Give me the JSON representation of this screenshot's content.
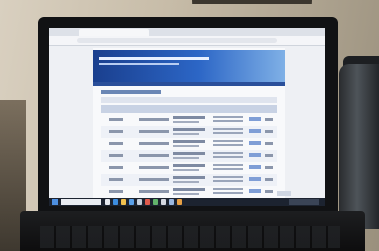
{
  "scene": {
    "subject": "laptop-displaying-web-page",
    "browser": {
      "tab_title": "",
      "address": ""
    },
    "web_page": {
      "site_title": "",
      "row_count": 7
    },
    "colors": {
      "banner": "#2c66c6",
      "taskbar": "#1c2330",
      "table_header": "#c8d2e4"
    },
    "taskbar_icons": [
      "windows-start-icon",
      "search-box",
      "task-view-icon",
      "edge-icon",
      "file-explorer-icon",
      "store-icon",
      "mail-icon",
      "app-icon",
      "app-icon",
      "app-icon",
      "app-icon",
      "app-icon"
    ]
  }
}
